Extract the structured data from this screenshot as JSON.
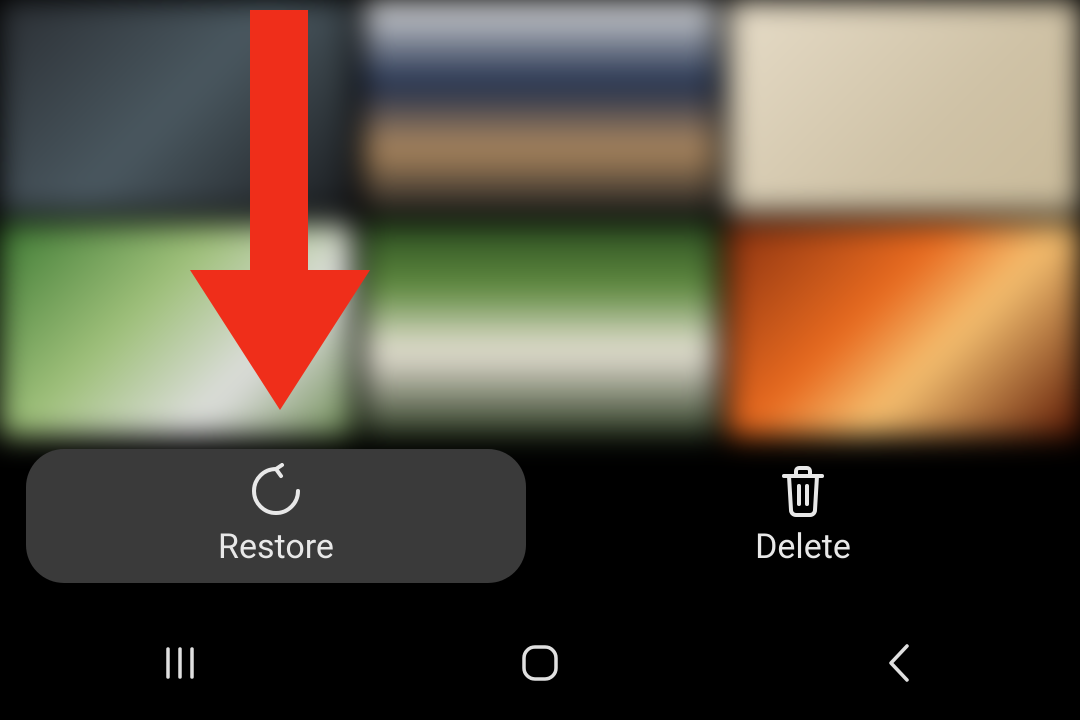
{
  "actions": {
    "restore": {
      "label": "Restore"
    },
    "delete": {
      "label": "Delete"
    }
  },
  "annotation": {
    "arrow_color": "#ef2e1a",
    "arrow_target": "restore-button"
  },
  "nav": {
    "recents": "recents",
    "home": "home",
    "back": "back"
  }
}
